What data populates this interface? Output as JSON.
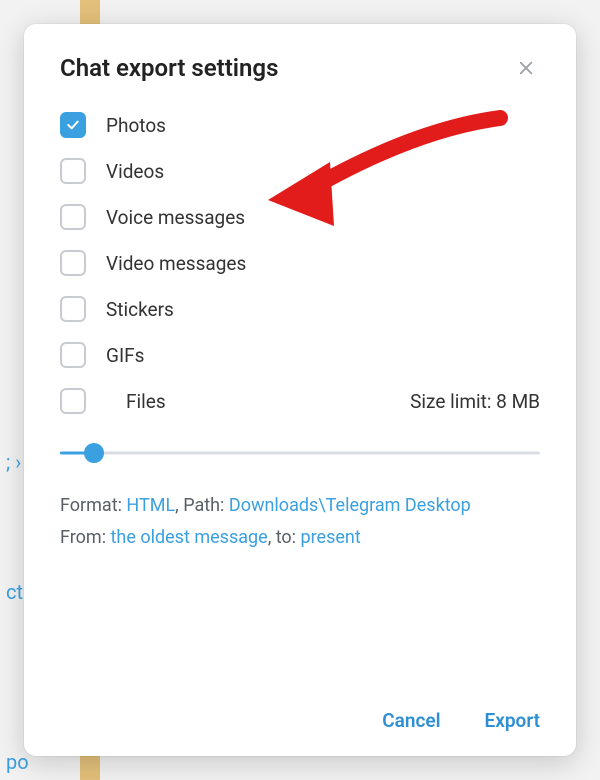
{
  "dialog": {
    "title": "Chat export settings"
  },
  "options": [
    {
      "label": "Photos",
      "checked": true
    },
    {
      "label": "Videos",
      "checked": false
    },
    {
      "label": "Voice messages",
      "checked": false
    },
    {
      "label": "Video messages",
      "checked": false
    },
    {
      "label": "Stickers",
      "checked": false
    },
    {
      "label": "GIFs",
      "checked": false
    },
    {
      "label": "Files",
      "checked": false
    }
  ],
  "size_limit": {
    "label_prefix": "Size limit: ",
    "value": "8 MB"
  },
  "slider": {
    "percent": 7
  },
  "info": {
    "format_label": "Format: ",
    "format_value": "HTML",
    "sep1": ", ",
    "path_label": "Path: ",
    "path_value": "Downloads\\Telegram Desktop",
    "from_label": "From: ",
    "from_value": "the oldest message",
    "sep2": ", ",
    "to_label": "to: ",
    "to_value": "present"
  },
  "footer": {
    "cancel": "Cancel",
    "export": "Export"
  }
}
